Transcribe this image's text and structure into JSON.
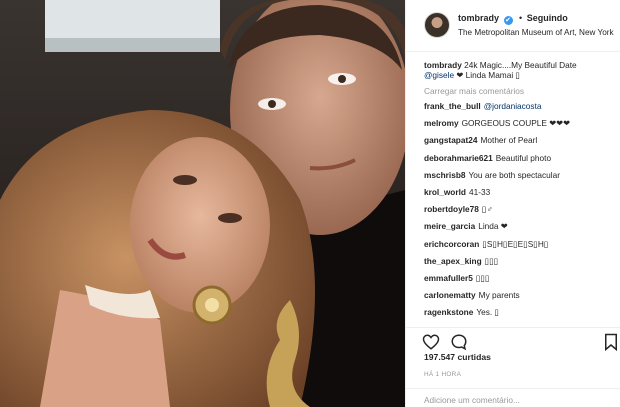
{
  "post": {
    "username": "tombrady",
    "verified_badge": "✔",
    "separator": "•",
    "follow_label": "Seguindo",
    "location": "The Metropolitan Museum of Art, New York",
    "photo_alt": "tombrady-selfie"
  },
  "caption": {
    "username": "tombrady",
    "text_before": "24k Magic....My Beautiful Date",
    "mention": "@gisele",
    "text_after": "❤ Linda Mamai ▯"
  },
  "load_more_label": "Carregar mais comentários",
  "comments": [
    {
      "user": "frank_the_bull",
      "text": "@jordaniacosta",
      "is_mention": true
    },
    {
      "user": "melromy",
      "text": "GORGEOUS COUPLE ❤❤❤",
      "is_mention": false
    },
    {
      "user": "gangstapat24",
      "text": "Mother of Pearl",
      "is_mention": false
    },
    {
      "user": "deborahmarie621",
      "text": "Beautiful photo",
      "is_mention": false
    },
    {
      "user": "mschrisb8",
      "text": "You are both spectacular",
      "is_mention": false
    },
    {
      "user": "krol_world",
      "text": "41-33",
      "is_mention": false
    },
    {
      "user": "robertdoyle78",
      "text": "▯♂",
      "is_mention": false
    },
    {
      "user": "meire_garcia",
      "text": "Linda ❤",
      "is_mention": false
    },
    {
      "user": "erichcorcoran",
      "text": "▯S▯H▯E▯E▯S▯H▯",
      "is_mention": false
    },
    {
      "user": "the_apex_king",
      "text": "▯▯▯",
      "is_mention": false
    },
    {
      "user": "emmafuller5",
      "text": "▯▯▯",
      "is_mention": false
    },
    {
      "user": "carlonematty",
      "text": "My parents",
      "is_mention": false
    },
    {
      "user": "ragenkstone",
      "text": "Yes. ▯",
      "is_mention": false
    }
  ],
  "actions": {
    "like_icon": "heart-icon",
    "comment_icon": "comment-bubble-icon",
    "save_icon": "bookmark-icon"
  },
  "likes_label": "197.547 curtidas",
  "time_label": "HÁ 1 HORA",
  "add_comment_placeholder": "Adicione um comentário...",
  "colors": {
    "link": "#003569",
    "verified": "#3897f0",
    "muted": "#999999",
    "border": "#efefef"
  }
}
